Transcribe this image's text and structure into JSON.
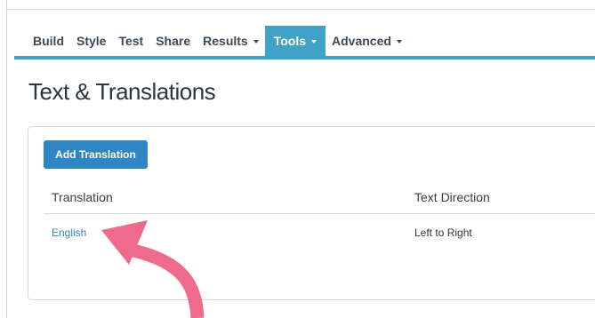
{
  "nav": {
    "items": [
      {
        "label": "Build",
        "dropdown": false,
        "active": false
      },
      {
        "label": "Style",
        "dropdown": false,
        "active": false
      },
      {
        "label": "Test",
        "dropdown": false,
        "active": false
      },
      {
        "label": "Share",
        "dropdown": false,
        "active": false
      },
      {
        "label": "Results",
        "dropdown": true,
        "active": false
      },
      {
        "label": "Tools",
        "dropdown": true,
        "active": true
      },
      {
        "label": "Advanced",
        "dropdown": true,
        "active": false
      }
    ]
  },
  "page": {
    "title": "Text & Translations"
  },
  "panel": {
    "add_button_label": "Add Translation",
    "table": {
      "columns": [
        "Translation",
        "Text Direction"
      ],
      "rows": [
        {
          "translation": "English",
          "direction": "Left to Right"
        }
      ]
    }
  },
  "colors": {
    "accent": "#3fa2c6",
    "button": "#2f86c4",
    "link": "#2f86c4",
    "annotation_arrow": "#f06a8c"
  }
}
